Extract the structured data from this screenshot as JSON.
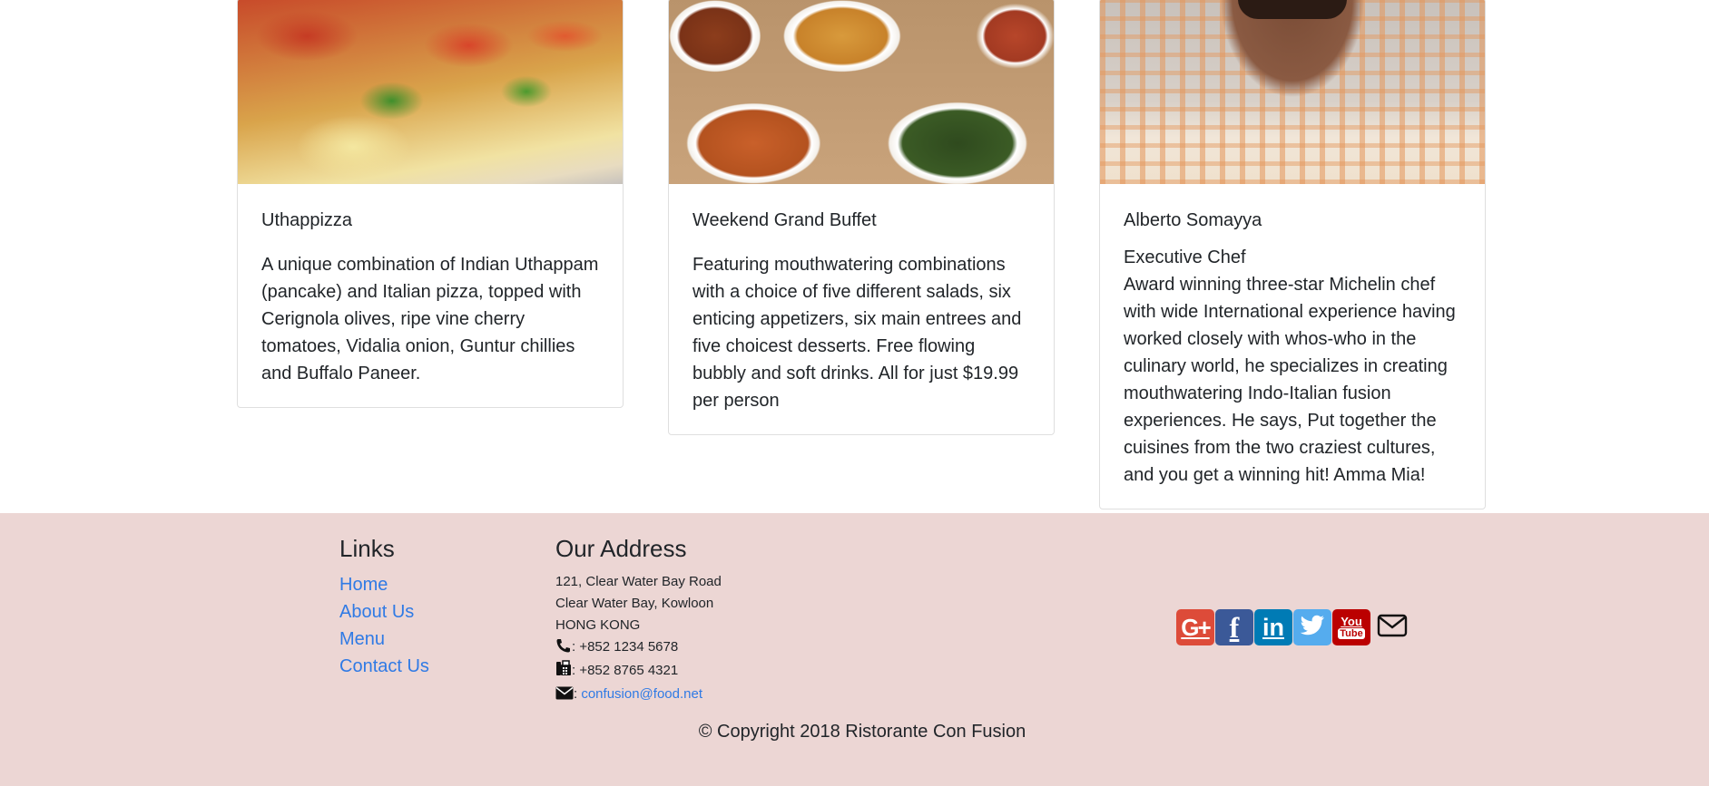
{
  "cards": [
    {
      "image": "pizza-image",
      "title": "Uthappizza",
      "subtitle": "",
      "text": "A unique combination of Indian Uthappam (pancake) and Italian pizza, topped with Cerignola olives, ripe vine cherry tomatoes, Vidalia onion, Guntur chillies and Buffalo Paneer."
    },
    {
      "image": "buffet-image",
      "title": "Weekend Grand Buffet",
      "subtitle": "",
      "text": "Featuring mouthwatering combinations with a choice of five different salads, six enticing appetizers, six main entrees and five choicest desserts. Free flowing bubbly and soft drinks. All for just $19.99 per person"
    },
    {
      "image": "chef-image",
      "title": "Alberto Somayya",
      "subtitle": "Executive Chef",
      "text": "Award winning three-star Michelin chef with wide International experience having worked closely with whos-who in the culinary world, he specializes in creating mouthwatering Indo-Italian fusion experiences. He says, Put together the cuisines from the two craziest cultures, and you get a winning hit! Amma Mia!"
    }
  ],
  "footer": {
    "links_heading": "Links",
    "links": [
      "Home",
      "About Us",
      "Menu",
      "Contact Us"
    ],
    "address_heading": "Our Address",
    "address_lines": [
      "121, Clear Water Bay Road",
      "Clear Water Bay, Kowloon",
      "HONG KONG"
    ],
    "phone": ": +852 1234 5678",
    "fax": ": +852 8765 4321",
    "email_sep": ": ",
    "email": "confusion@food.net",
    "social": [
      "google-plus",
      "facebook",
      "linkedin",
      "twitter",
      "youtube",
      "email"
    ],
    "social_labels": {
      "gplus": "G+",
      "fb": "f",
      "li": "in",
      "yt_top": "You",
      "yt_bottom": "Tube"
    },
    "copyright": "© Copyright 2018 Ristorante Con Fusion"
  },
  "colors": {
    "footer_bg": "#ecd6d4",
    "link": "#2f7ae5"
  }
}
